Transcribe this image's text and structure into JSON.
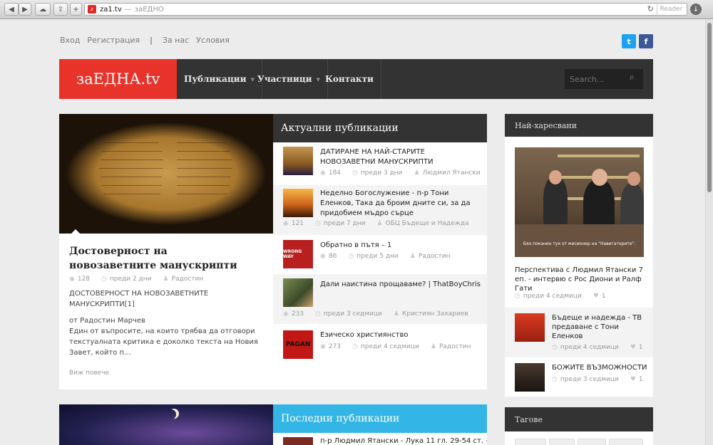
{
  "browser": {
    "url_domain": "za1.tv",
    "url_sep": "—",
    "url_title": "заЕДНО",
    "reader_label": "Reader",
    "favicon_text": "z"
  },
  "toplinks": {
    "login": "Вход",
    "register": "Регистрация",
    "separator": "|",
    "about": "За нас",
    "terms": "Условия"
  },
  "social": {
    "twitter": "t",
    "facebook": "f"
  },
  "nav": {
    "logo": "заЕДНА.tv",
    "items": [
      {
        "label": "Публикации",
        "dropdown": true
      },
      {
        "label": "Участници",
        "dropdown": true
      },
      {
        "label": "Контакти",
        "dropdown": false
      }
    ],
    "search_placeholder": "Search..."
  },
  "featured": {
    "title": "Достоверност на новозаветните манускрипти",
    "views": "128",
    "date": "преди 2 дни",
    "author": "Радостин",
    "excerpt_title": "ДОСТОВЕРНОСТ НА НОВОЗАВЕТНИТЕ МАНУСКРИПТИ[1]",
    "excerpt_author": "от Радостин Марчев",
    "excerpt_body": "Един от въпросите, на които трябва да отговори текстуалната критика е доколко текста на Новия Завет, който п…",
    "more_label": "Виж повече"
  },
  "actual": {
    "header": "Актуални публикации",
    "items": [
      {
        "title": "ДАТИРАНЕ НА НАЙ-СТАРИТЕ НОВОЗАВЕТНИ МАНУСКРИПТИ",
        "views": "184",
        "date": "преди 3 дни",
        "author": "Людмил Ятански"
      },
      {
        "title": "Неделно Богослужение - п-р Тони Еленков, Така да броим дните си, за да придобием мъдро сърце",
        "views": "121",
        "date": "преди 7 дни",
        "author": "ОБЦ Бъдеще и Надежда"
      },
      {
        "title": "Обратно в пътя – 1",
        "views": "86",
        "date": "преди 5 дни",
        "author": "Радостин"
      },
      {
        "title": "Дали наистина прощаваме? | ThatBoyChris",
        "views": "233",
        "date": "преди 3 седмици",
        "author": "Кристиян Захариев"
      },
      {
        "title": "Езическо християнство",
        "views": "273",
        "date": "преди 4 седмици",
        "author": "Радостин"
      }
    ]
  },
  "sidebar": {
    "header": "Най-харесвани",
    "main_caption": "Бях поканен тук от мисионер на \"Навигаторите\".",
    "main_title": "Перспектива с Людмил Ятански 7 еп. - интервю с Рос Диони и Ралф Гати",
    "main_date": "преди 4 седмици",
    "main_likes": "1",
    "items": [
      {
        "title": "Бъдеще и надежда - ТВ предаване с Тони Еленков",
        "date": "преди 4 седмици",
        "likes": "1"
      },
      {
        "title": "БОЖИТЕ ВЪЗМОЖНОСТИ",
        "date": "преди 3 седмици",
        "likes": "1"
      }
    ]
  },
  "latest": {
    "header": "Последни публикации",
    "first_title": "п-р Людмил Ятански - Лука 11 гл. 29-54 ст. -"
  },
  "tags": {
    "header": "Тагове"
  },
  "thumbs": {
    "wrong_way": "WRONG WAY",
    "pagan": "PAGAN"
  },
  "colors": {
    "brand_red": "#e8332a",
    "nav_dark": "#333333",
    "accent_blue": "#33b5e5",
    "twitter": "#1da1f2",
    "facebook": "#3b5998"
  }
}
